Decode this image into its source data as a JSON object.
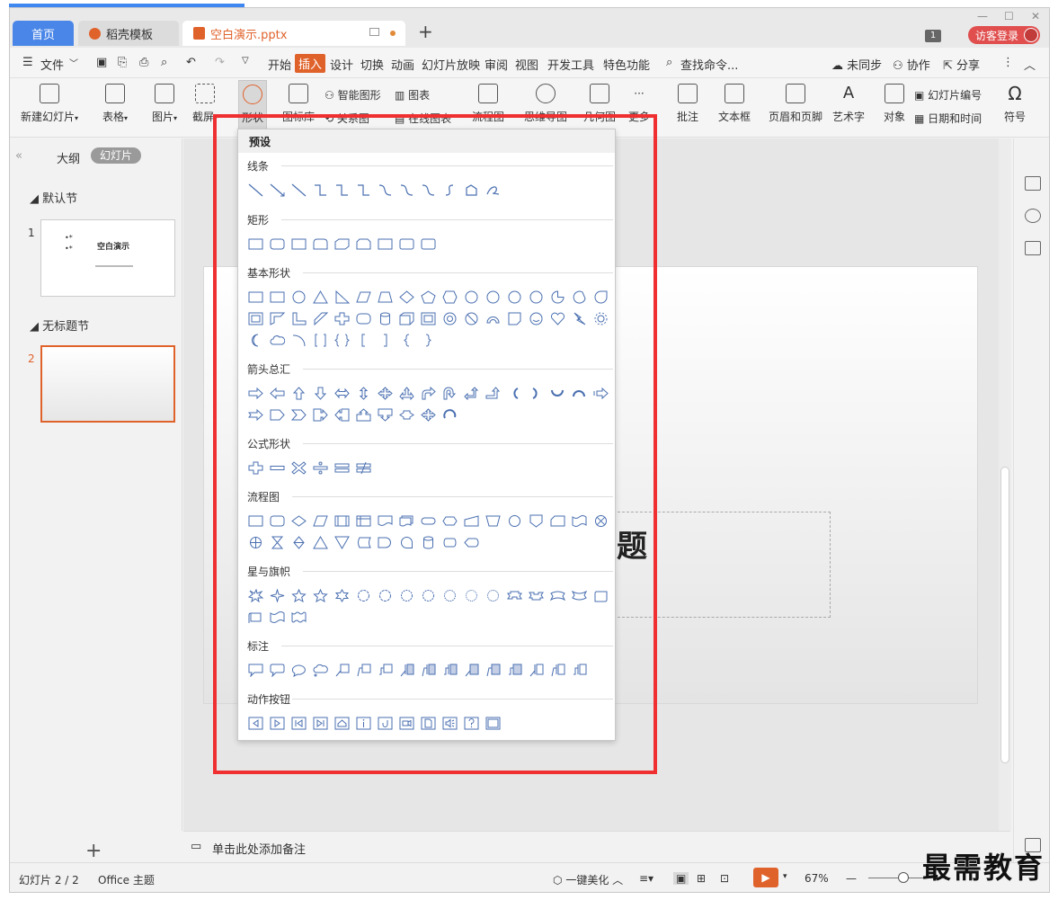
{
  "tabs": {
    "home": "首页",
    "templates": "稻壳模板",
    "document": "空白演示.pptx",
    "new_tab": "+"
  },
  "titlebar": {
    "badge": "1",
    "login": "访客登录"
  },
  "menu": {
    "file": "文件",
    "items": [
      "开始",
      "插入",
      "设计",
      "切换",
      "动画",
      "幻灯片放映",
      "审阅",
      "视图",
      "开发工具",
      "特色功能"
    ],
    "search": "查找命令...",
    "right": [
      "未同步",
      "协作",
      "分享"
    ]
  },
  "ribbon": {
    "new_slide": "新建幻灯片",
    "table": "表格",
    "picture": "图片",
    "screenshot": "截屏",
    "shape": "形状",
    "icon_lib": "图标库",
    "smart_shape": "智能图形",
    "chart": "图表",
    "relation": "关系图",
    "online_chart": "在线图表",
    "flowchart": "流程图",
    "mindmap": "思维导图",
    "geometry": "几何图",
    "more": "更多",
    "comment": "批注",
    "textbox": "文本框",
    "header_footer": "页眉和页脚",
    "wordart": "艺术字",
    "object": "对象",
    "slide_number": "幻灯片编号",
    "datetime": "日期和时间",
    "symbol": "符号"
  },
  "sidebar": {
    "outline": "大纲",
    "slides": "幻灯片",
    "section1": "默认节",
    "section2": "无标题节",
    "slide1_num": "1",
    "slide2_num": "2",
    "slide1_title": "空白演示",
    "add": "+"
  },
  "canvas": {
    "title_fragment": "题"
  },
  "notes": "单击此处添加备注",
  "status": {
    "slide_info": "幻灯片 2 / 2",
    "theme": "Office 主题",
    "beautify": "一键美化",
    "zoom": "67%"
  },
  "watermark": "最需教育",
  "shapes_panel": {
    "header": "预设",
    "categories": [
      "线条",
      "矩形",
      "基本形状",
      "箭头总汇",
      "公式形状",
      "流程图",
      "星与旗帜",
      "标注",
      "动作按钮"
    ]
  },
  "accent_color": "#e0622b",
  "highlight_color": "#f03030"
}
